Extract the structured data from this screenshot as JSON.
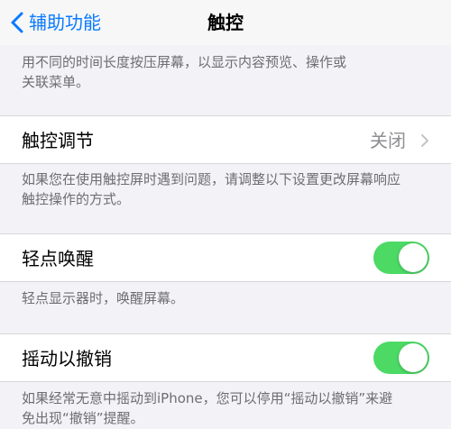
{
  "navbar": {
    "back_label": "辅助功能",
    "title": "触控"
  },
  "top_footer": {
    "line1": "用不同的时间长度按压屏幕，以显示内容预览、操作或",
    "line2": "关联菜单。"
  },
  "touch_accommodations": {
    "label": "触控调节",
    "value": "关闭",
    "footer_line1": "如果您在使用触控屏时遇到问题，请调整以下设置更改屏幕响应",
    "footer_line2": "触控操作的方式。"
  },
  "tap_to_wake": {
    "label": "轻点唤醒",
    "enabled": true,
    "footer": "轻点显示器时，唤醒屏幕。"
  },
  "shake_to_undo": {
    "label": "摇动以撤销",
    "enabled": true,
    "footer_line1": "如果经常无意中摇动到iPhone，您可以停用“摇动以撤销”来避",
    "footer_line2": "免出现“撤销”提醒。"
  },
  "colors": {
    "accent": "#0a7aff",
    "toggle_on": "#4cd964",
    "background": "#f2f2f7"
  }
}
